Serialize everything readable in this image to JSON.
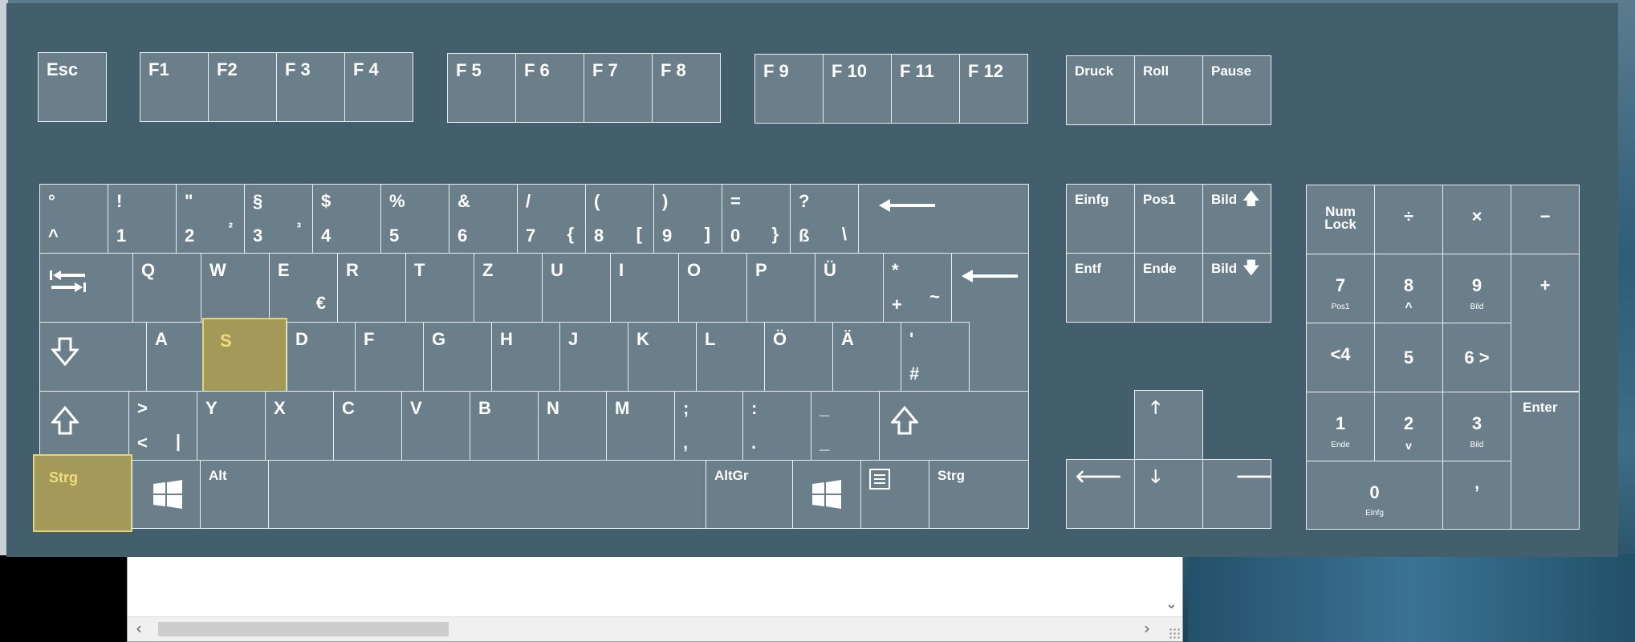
{
  "colors": {
    "keyboard_bg": "#445f6c",
    "key_bg": "#6b7f8a",
    "key_border": "#e6eef2",
    "highlight_bg": "#a39a5a",
    "highlight_text": "#f1dc7c"
  },
  "function_row": {
    "esc": "Esc",
    "f1": "F1",
    "f2": "F2",
    "f3": "F 3",
    "f4": "F 4",
    "f5": "F 5",
    "f6": "F 6",
    "f7": "F 7",
    "f8": "F 8",
    "f9": "F 9",
    "f10": "F 10",
    "f11": "F 11",
    "f12": "F 12",
    "druck": "Druck",
    "roll": "Roll",
    "pause": "Pause"
  },
  "number_row": [
    {
      "top": "°",
      "bottom": "^"
    },
    {
      "top": "!",
      "bottom": "1"
    },
    {
      "top": "\"",
      "bottom": "2",
      "altgr": "²"
    },
    {
      "top": "§",
      "bottom": "3",
      "altgr": "³"
    },
    {
      "top": "$",
      "bottom": "4"
    },
    {
      "top": "%",
      "bottom": "5"
    },
    {
      "top": "&",
      "bottom": "6"
    },
    {
      "top": "/",
      "bottom": "7",
      "altgr": "{"
    },
    {
      "top": "(",
      "bottom": "8",
      "altgr": "["
    },
    {
      "top": ")",
      "bottom": "9",
      "altgr": "]"
    },
    {
      "top": "=",
      "bottom": "0",
      "altgr": "}"
    },
    {
      "top": "?",
      "bottom": "ß",
      "altgr": "\\"
    }
  ],
  "qwertz_row": [
    "Q",
    "W",
    "E",
    "R",
    "T",
    "Z",
    "U",
    "I",
    "O",
    "P",
    "Ü"
  ],
  "e_altgr": "€",
  "plus_key": {
    "top": "*",
    "bottom": "+",
    "altgr": "~"
  },
  "home_row": [
    "A",
    "S",
    "D",
    "F",
    "G",
    "H",
    "J",
    "K",
    "L",
    "Ö",
    "Ä"
  ],
  "hash_key": {
    "top": "'",
    "bottom": "#"
  },
  "shift_row": {
    "angle": {
      "top": ">",
      "bottom": "<",
      "altgr": "|"
    },
    "letters": [
      "Y",
      "X",
      "C",
      "V",
      "B",
      "N",
      "M"
    ],
    "comma": {
      "top": ";",
      "bottom": ","
    },
    "period": {
      "top": ":",
      "bottom": "."
    },
    "minus": {
      "top": "_",
      "bottom": "_"
    }
  },
  "bottom_row": {
    "strg_left": "Strg",
    "alt": "Alt",
    "altgr": "AltGr",
    "strg_right": "Strg"
  },
  "nav_cluster": {
    "einfg": "Einfg",
    "pos1": "Pos1",
    "bild_up": "Bild",
    "entf": "Entf",
    "ende": "Ende",
    "bild_down": "Bild"
  },
  "numpad": {
    "numlock": "Num",
    "numlock2": "Lock",
    "divide": "÷",
    "multiply": "×",
    "minus": "−",
    "plus": "+",
    "n7": "7",
    "n7_sub": "Pos1",
    "n8": "8",
    "n8_sub": "^",
    "n9": "9",
    "n9_sub": "Bild",
    "n4": "<4",
    "n5": "5",
    "n6": "6 >",
    "n1": "1",
    "n1_sub": "Ende",
    "n2": "2",
    "n2_sub": "v",
    "n3": "3",
    "n3_sub": "Bild",
    "n0": "0",
    "n0_sub": "Einfg",
    "decimal": ",",
    "enter": "Enter"
  },
  "highlighted_keys": [
    "S",
    "Strg"
  ]
}
